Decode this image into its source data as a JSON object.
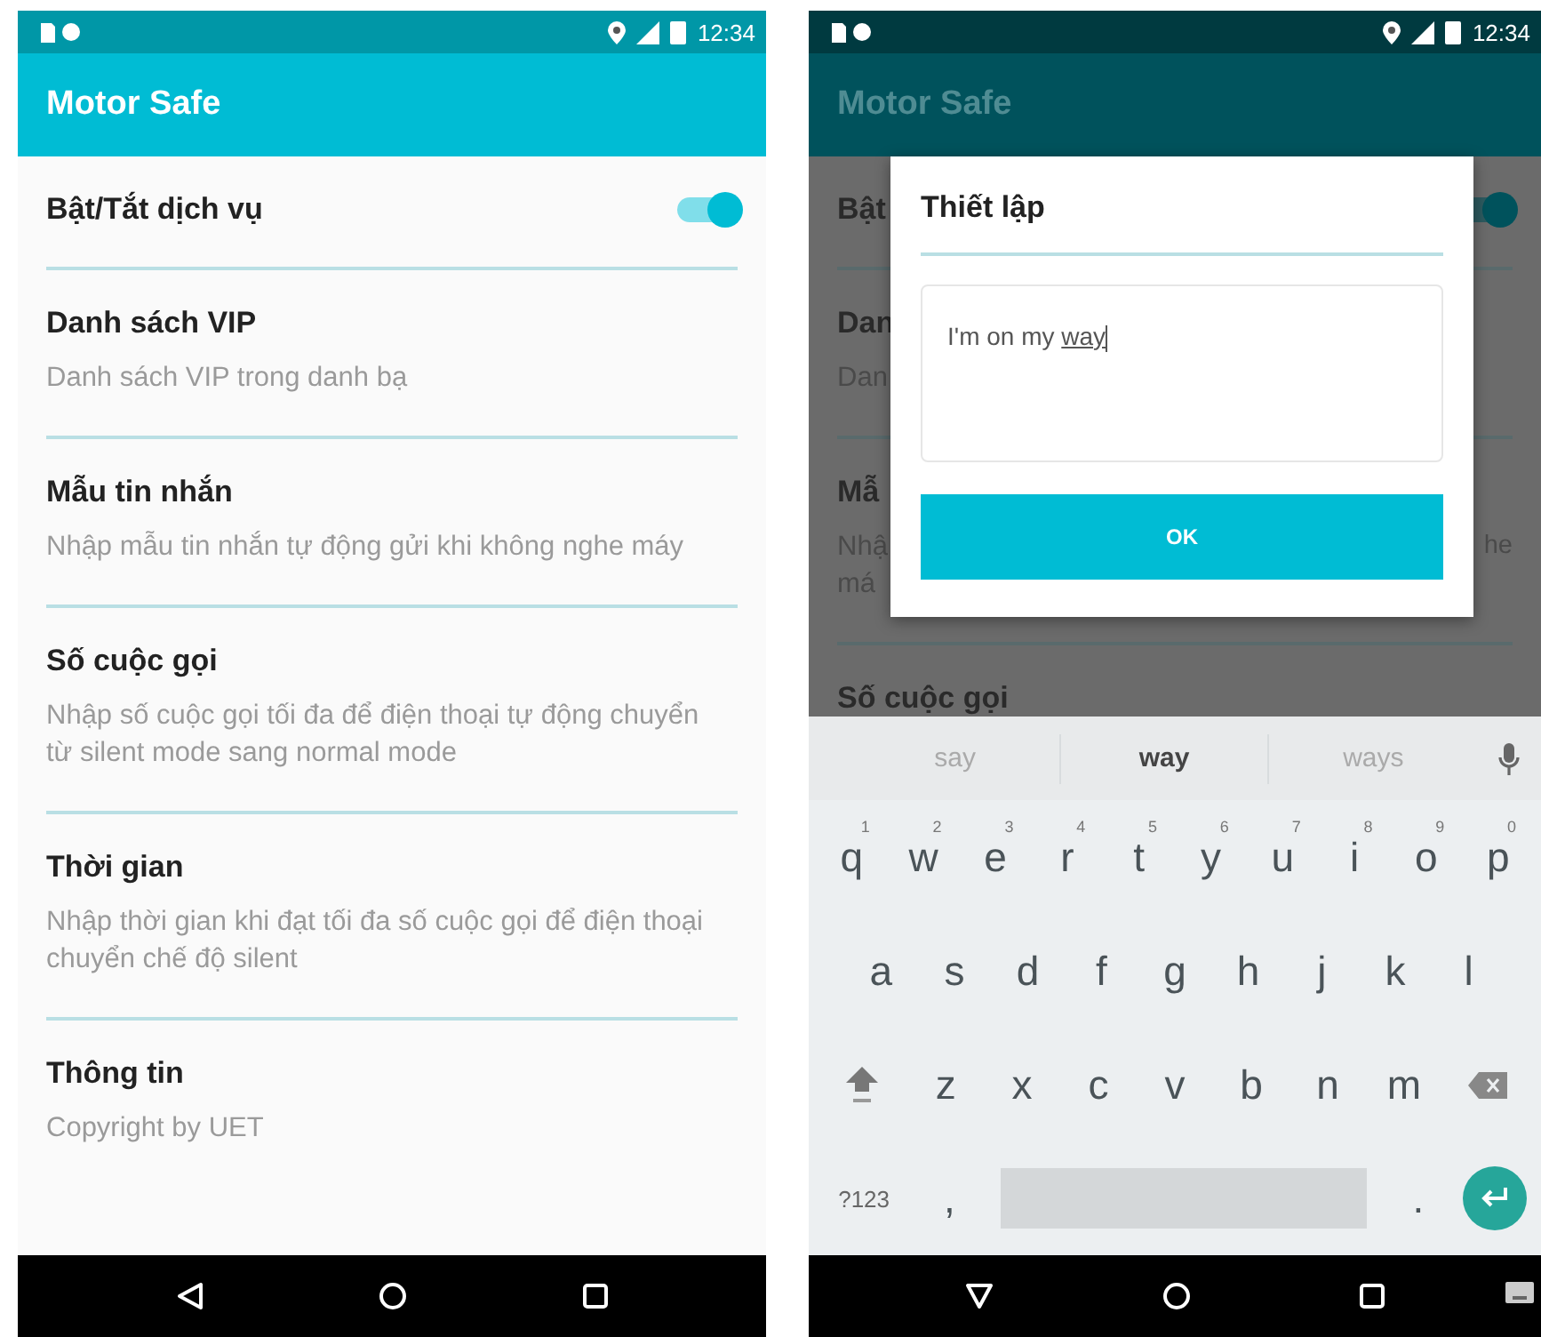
{
  "screens": [
    {
      "dimmed": false,
      "status_bar": {
        "time": "12:34"
      },
      "app_bar": {
        "title": "Motor Safe"
      },
      "settings": [
        {
          "kind": "toggle",
          "title": "Bật/Tắt dịch vụ",
          "on": true
        },
        {
          "kind": "text",
          "title": "Danh sách VIP",
          "summary": [
            "Danh sách VIP trong danh bạ"
          ]
        },
        {
          "kind": "text",
          "title": "Mẫu tin nhắn",
          "summary": [
            "Nhập mẫu tin nhắn tự động gửi khi không nghe máy"
          ]
        },
        {
          "kind": "text",
          "title": "Số cuộc gọi",
          "summary": [
            "Nhập số cuộc gọi tối đa để điện thoại tự động chuyển từ silent mode sang normal mode"
          ]
        },
        {
          "kind": "text",
          "title": "Thời gian",
          "summary": [
            "Nhập thời gian khi đạt tối đa số cuộc gọi để điện thoại chuyển chế độ silent"
          ]
        },
        {
          "kind": "text",
          "title": "Thông tin",
          "summary": [
            "Copyright by UET"
          ]
        }
      ],
      "nav_bar": {
        "keyboard_open": false
      }
    },
    {
      "dimmed": true,
      "status_bar": {
        "time": "12:34"
      },
      "app_bar": {
        "title": "Motor Safe"
      },
      "settings": [
        {
          "kind": "toggle",
          "title": "Bật",
          "on": true
        },
        {
          "kind": "text",
          "title": "Dan",
          "summary": [
            "Dan"
          ]
        },
        {
          "kind": "text",
          "title": "Mẫ",
          "summary": [
            "Nhậ",
            "má"
          ],
          "right": "he"
        },
        {
          "kind": "text",
          "title": "Số cuộc gọi"
        }
      ],
      "dialog": {
        "title": "Thiết lập",
        "value": "I'm on my ",
        "composing": "way",
        "button": "OK"
      },
      "keyboard": {
        "suggestions": [
          {
            "text": "say",
            "selected": false
          },
          {
            "text": "way",
            "selected": true
          },
          {
            "text": "ways",
            "selected": false
          }
        ],
        "rows": [
          [
            {
              "label": "q",
              "hint": "1"
            },
            {
              "label": "w",
              "hint": "2"
            },
            {
              "label": "e",
              "hint": "3"
            },
            {
              "label": "r",
              "hint": "4"
            },
            {
              "label": "t",
              "hint": "5"
            },
            {
              "label": "y",
              "hint": "6"
            },
            {
              "label": "u",
              "hint": "7"
            },
            {
              "label": "i",
              "hint": "8"
            },
            {
              "label": "o",
              "hint": "9"
            },
            {
              "label": "p",
              "hint": "0"
            }
          ],
          [
            {
              "label": "a"
            },
            {
              "label": "s"
            },
            {
              "label": "d"
            },
            {
              "label": "f"
            },
            {
              "label": "g"
            },
            {
              "label": "h"
            },
            {
              "label": "j"
            },
            {
              "label": "k"
            },
            {
              "label": "l"
            }
          ],
          [
            {
              "kind": "shift"
            },
            {
              "label": "z"
            },
            {
              "label": "x"
            },
            {
              "label": "c"
            },
            {
              "label": "v"
            },
            {
              "label": "b"
            },
            {
              "label": "n"
            },
            {
              "label": "m"
            },
            {
              "kind": "backspace"
            }
          ],
          [
            {
              "kind": "symbols",
              "label": "?123"
            },
            {
              "label": ","
            },
            {
              "kind": "space"
            },
            {
              "label": "."
            },
            {
              "kind": "enter"
            }
          ]
        ]
      },
      "nav_bar": {
        "keyboard_open": true
      }
    }
  ]
}
